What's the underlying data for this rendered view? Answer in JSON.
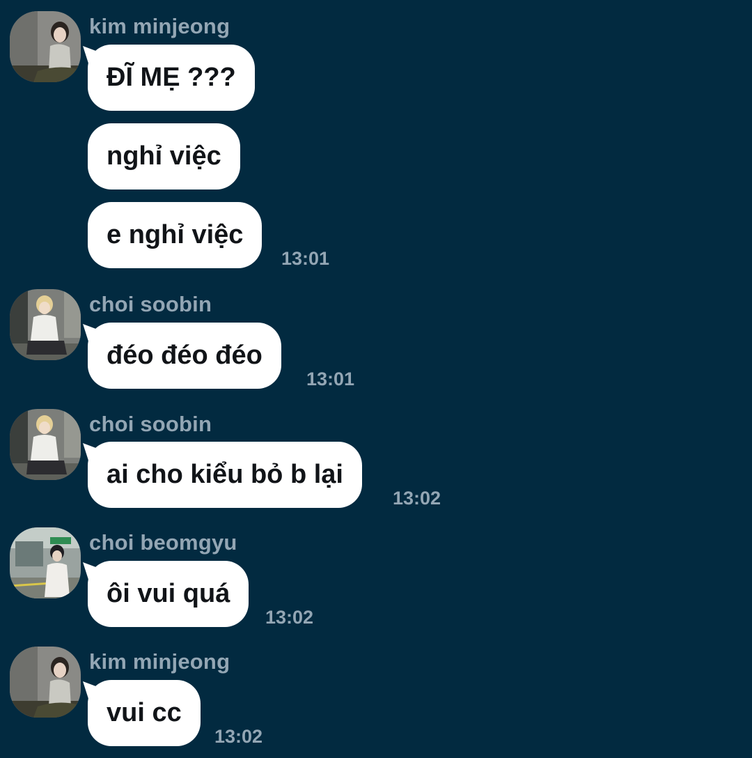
{
  "colors": {
    "background": "#022a40",
    "bubble": "#ffffff",
    "meta_text": "#93a6b4",
    "message_text": "#111418"
  },
  "groups": [
    {
      "sender": "kim minjeong",
      "avatar": "avatar-kim-minjeong",
      "messages": [
        {
          "text": "ĐĨ MẸ ???",
          "time": ""
        },
        {
          "text": "nghỉ việc",
          "time": ""
        },
        {
          "text": "e nghỉ việc",
          "time": "13:01"
        }
      ]
    },
    {
      "sender": "choi soobin",
      "avatar": "avatar-choi-soobin",
      "messages": [
        {
          "text": "đéo đéo đéo",
          "time": "13:01"
        }
      ]
    },
    {
      "sender": "choi soobin",
      "avatar": "avatar-choi-soobin",
      "messages": [
        {
          "text": "ai cho kiểu bỏ b lại",
          "time": "13:02"
        }
      ]
    },
    {
      "sender": "choi beomgyu",
      "avatar": "avatar-choi-beomgyu",
      "messages": [
        {
          "text": "ôi vui quá",
          "time": "13:02"
        }
      ]
    },
    {
      "sender": "kim minjeong",
      "avatar": "avatar-kim-minjeong",
      "messages": [
        {
          "text": "vui cc",
          "time": "13:02"
        }
      ]
    }
  ]
}
